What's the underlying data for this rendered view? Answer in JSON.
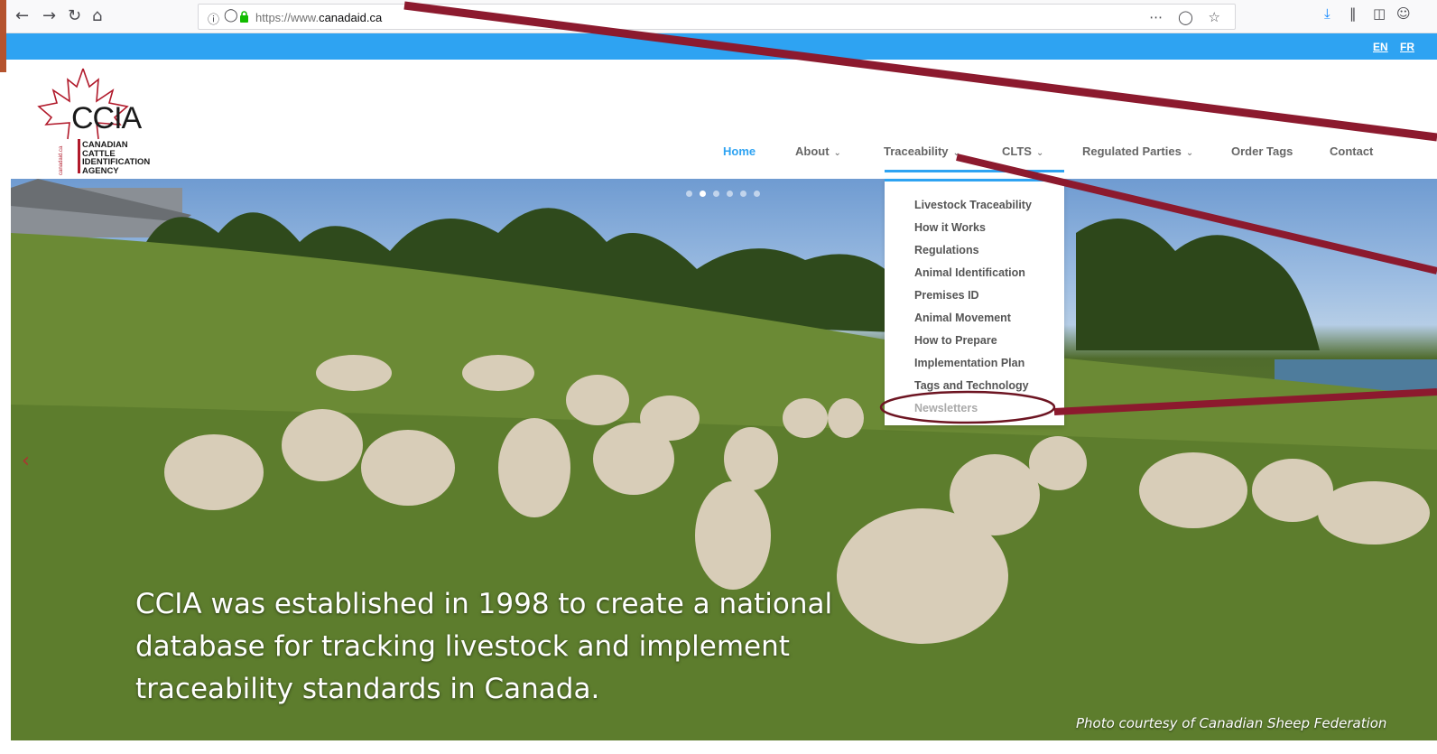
{
  "browser": {
    "url_prefix": "https://www.",
    "url_domain": "canadaid.ca",
    "back_icon": "back-arrow-icon",
    "forward_icon": "forward-arrow-icon",
    "reload_icon": "reload-icon",
    "home_icon": "home-icon"
  },
  "lang": {
    "en": "EN",
    "fr": "FR"
  },
  "logo": {
    "acronym": "CCIA",
    "line1": "CANADIAN",
    "line2": "CATTLE",
    "line3": "IDENTIFICATION",
    "line4": "AGENCY",
    "side_text": "canadaid.ca"
  },
  "nav": {
    "home": "Home",
    "about": "About",
    "traceability": "Traceability",
    "clts": "CLTS",
    "regulated_parties": "Regulated Parties",
    "order_tags": "Order Tags",
    "contact": "Contact"
  },
  "dropdown": {
    "items": [
      "Livestock Traceability",
      "How it Works",
      "Regulations",
      "Animal Identification",
      "Premises ID",
      "Animal Movement",
      "How to Prepare",
      "Implementation Plan",
      "Tags and Technology",
      "Newsletters"
    ]
  },
  "hero": {
    "caption_line1": "CCIA was established in 1998 to create a national",
    "caption_line2": "database for tracking livestock and implement",
    "caption_line3": "traceability standards in Canada.",
    "photo_credit": "Photo courtesy of Canadian Sheep Federation",
    "slide_count": 6,
    "active_slide": 2
  },
  "colors": {
    "accent_blue": "#2ea3f2",
    "annotation_maroon": "#8c1a2e"
  }
}
